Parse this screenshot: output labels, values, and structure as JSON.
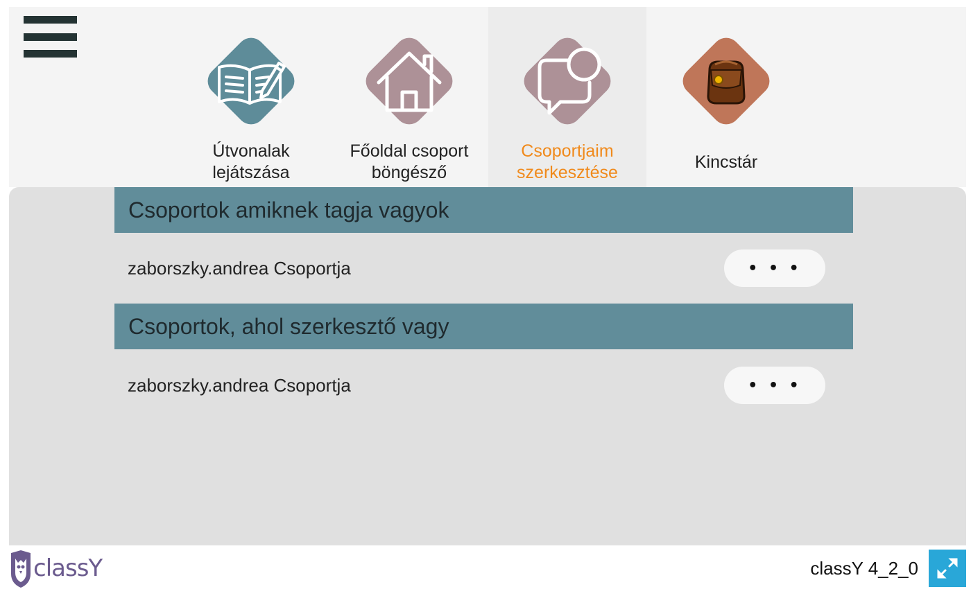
{
  "nav": {
    "tabs": [
      {
        "label_line1": "Útvonalak",
        "label_line2": "lejátszása",
        "icon": "open-book-pen-icon",
        "color": "#5e8c99"
      },
      {
        "label_line1": "Főoldal csoport",
        "label_line2": "böngésző",
        "icon": "house-icon",
        "color": "#ad9197"
      },
      {
        "label_line1": "Csoportjaim",
        "label_line2": "szerkesztése",
        "icon": "speech-bubble-user-icon",
        "color": "#ad9197",
        "active": true
      },
      {
        "label_line1": "Kincstár",
        "label_line2": "",
        "icon": "treasure-bag-icon",
        "color": "#bf7659"
      }
    ],
    "active_color": "#f08a1c"
  },
  "sections": [
    {
      "title": "Csoportok amiknek tagja vagyok",
      "groups": [
        {
          "name": "zaborszky.andrea Csoportja",
          "action": "• • •"
        }
      ]
    },
    {
      "title": "Csoportok, ahol szerkesztő vagy",
      "groups": [
        {
          "name": "zaborszky.andrea Csoportja",
          "action": "• • •"
        }
      ]
    }
  ],
  "footer": {
    "logo_text": "classY",
    "version": "classY 4_2_0",
    "fullscreen_icon": "expand-arrows-icon"
  },
  "colors": {
    "header_bg": "#f4f4f4",
    "panel_bg": "#e0e0e0",
    "section_header_bg": "#618d9a",
    "fullscreen_bg": "#29a7d8"
  }
}
